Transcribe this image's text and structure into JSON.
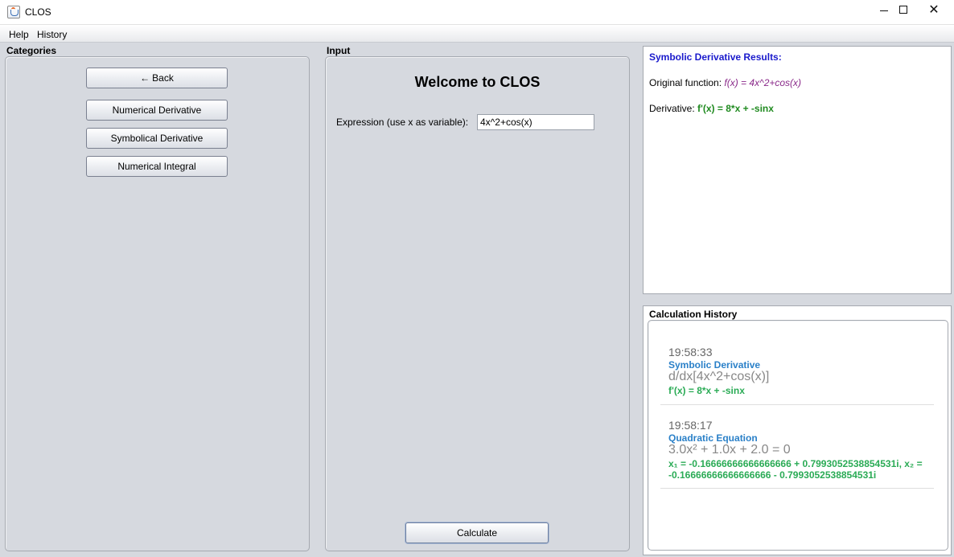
{
  "window": {
    "title": "CLOS"
  },
  "menu": {
    "help": "Help",
    "history": "History"
  },
  "categories": {
    "label": "Categories",
    "buttons": {
      "back": "Back",
      "numerical_derivative": "Numerical Derivative",
      "symbolical_derivative": "Symbolical Derivative",
      "numerical_integral": "Numerical Integral"
    }
  },
  "input": {
    "label": "Input",
    "welcome": "Welcome to CLOS",
    "expression_label": "Expression (use x as variable):",
    "expression_value": "4x^2+cos(x)",
    "calculate": "Calculate"
  },
  "results": {
    "heading": "Symbolic Derivative Results:",
    "original_label": "Original function: ",
    "original_value": "f(x) = 4x^2+cos(x)",
    "derivative_label": "Derivative: ",
    "derivative_value": "f'(x) = 8*x + -sinx"
  },
  "history": {
    "title": "Calculation History",
    "entries": [
      {
        "time": "19:58:33",
        "type": "Symbolic Derivative",
        "expression": "d/dx[4x^2+cos(x)]",
        "result": "f'(x) = 8*x + -sinx"
      },
      {
        "time": "19:58:17",
        "type": "Quadratic Equation",
        "expression": "3.0x² + 1.0x + 2.0 = 0",
        "result": "x₁ = -0.16666666666666666 + 0.7993052538854531i, x₂ = -0.16666666666666666 - 0.7993052538854531i"
      }
    ]
  },
  "colors": {
    "results_heading": "#1a1acc",
    "original_function": "#8a2a8a",
    "derivative": "#1f8a1f",
    "history_type": "#2a80c8",
    "history_result": "#2aab55"
  },
  "icons": {
    "app": "java-cup-icon",
    "back": "left-arrow-icon",
    "minimize": "minimize-icon",
    "maximize": "maximize-icon",
    "close": "close-icon"
  }
}
